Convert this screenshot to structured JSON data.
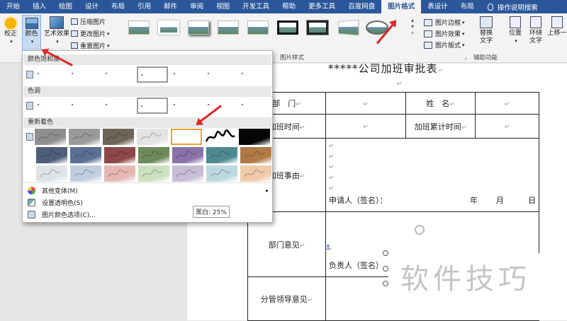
{
  "tabs": [
    "开始",
    "插入",
    "绘图",
    "设计",
    "布局",
    "引用",
    "邮件",
    "审阅",
    "视图",
    "开发工具",
    "帮助",
    "更多工具",
    "百度网盘",
    "图片格式",
    "表设计",
    "布局"
  ],
  "active_tab": 13,
  "tell_me": "操作说明搜索",
  "ribbon": {
    "correct": "校正",
    "color": "颜色",
    "art_effects": "艺术效果",
    "compress": "压缩图片",
    "change": "更改图片",
    "reset": "重置图片",
    "styles_group": "图片样式",
    "border": "图片边框",
    "effects": "图片效果",
    "layout": "图片版式",
    "alt_text": "替换文字",
    "accessibility_group": "辅助功能",
    "position": "位置",
    "wrap": "环绕文字",
    "bring_forward": "上移一"
  },
  "panel": {
    "saturation": "颜色饱和度",
    "tone": "色调",
    "recolor": "重新着色",
    "tooltip": "黑白: 25%",
    "more_variants": "其他变体(M)",
    "set_transparent": "设置透明色(S)",
    "color_options": "图片颜色选项(C)...",
    "recolor_colors": [
      [
        "#8f8f8f",
        "#9a9a9a",
        "#6d6657",
        "#e3e3e3",
        "#ffffff",
        "sig",
        "#050505"
      ],
      [
        "#4f5f7a",
        "#5a6f94",
        "#8d4848",
        "#6e8a5a",
        "#8a73a8",
        "#4f8a94",
        "#b07a45"
      ],
      [
        "#dfe3e8",
        "#c2cedf",
        "#e5b8b3",
        "#cde0be",
        "#c7bdd6",
        "#bcd9df",
        "#f0c9a8"
      ]
    ]
  },
  "doc": {
    "title": "*****公司加班审批表",
    "dept": "部　门",
    "name": "姓　名",
    "ot_time": "加班时间",
    "ot_total": "加班累计时间",
    "reason": "加班事由",
    "applicant": "申请人（签名）：",
    "year": "年",
    "month": "月",
    "day": "日",
    "dept_opinion": "部门意见",
    "responsible": "负责人（签名）",
    "leader_opinion": "分管领导意见"
  },
  "watermark": "软件技巧"
}
